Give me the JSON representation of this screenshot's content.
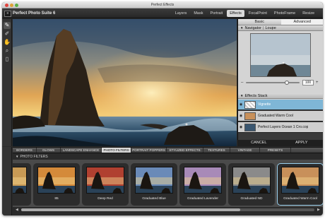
{
  "window": {
    "title": "Perfect Effects"
  },
  "app": {
    "name": "Perfect Photo Suite 6",
    "logo_glyph": "≡"
  },
  "modules": [
    "Layers",
    "Mask",
    "Portrait",
    "Effects",
    "FocalPoint",
    "PhotoFrame",
    "Resize"
  ],
  "active_module": "Effects",
  "tools": [
    {
      "name": "brush-icon",
      "glyph": "✎"
    },
    {
      "name": "eyedropper-icon",
      "glyph": "✐"
    },
    {
      "name": "hand-icon",
      "glyph": "✋"
    },
    {
      "name": "zoom-icon",
      "glyph": "⌕"
    },
    {
      "name": "compare-icon",
      "glyph": "▯"
    }
  ],
  "right_panel": {
    "tabs": [
      "Basic",
      "Advanced"
    ],
    "active_tab": "Advanced",
    "navigator": {
      "title": "Navigator",
      "tab2": "Loupe",
      "zoom": "100",
      "zoom_level": 0.78
    },
    "stack": {
      "title": "Effects Stack",
      "items": [
        {
          "name": "Vignette",
          "selected": true
        },
        {
          "name": "Graduated Warm Cool",
          "selected": false
        },
        {
          "name": "Perfect Layers Ocean 1 Cro.cop",
          "selected": false
        }
      ]
    }
  },
  "actions": {
    "cancel": "CANCEL",
    "apply": "APPLY"
  },
  "categories": [
    "BORDERS",
    "GLOWS",
    "LANDSCAPE ENHANCE",
    "PHOTO FILTERS",
    "PORTRAIT POPPERS",
    "STYLIZED EFFECTS",
    "TEXTURES",
    "VINTAGE",
    "PRESETS"
  ],
  "active_category": "PHOTO FILTERS",
  "filters_header": "PHOTO FILTERS",
  "filters": [
    {
      "label": "",
      "tint": "#c89a55"
    },
    {
      "label": "85",
      "tint": "#d48a3a"
    },
    {
      "label": "Deep Red",
      "tint": "#b04030"
    },
    {
      "label": "Graduated Blue",
      "tint": "#6a8ab8"
    },
    {
      "label": "Graduated Lavender",
      "tint": "#a88ab8"
    },
    {
      "label": "Graduated ND",
      "tint": "#8a8a8a"
    },
    {
      "label": "Graduated Warm Cool",
      "tint": "#c8905a"
    }
  ],
  "selected_filter": "Graduated Warm Cool",
  "colors": {
    "accent": "#7fb6d6",
    "panel": "#d4d4d4",
    "chrome": "#2b2b2b"
  }
}
